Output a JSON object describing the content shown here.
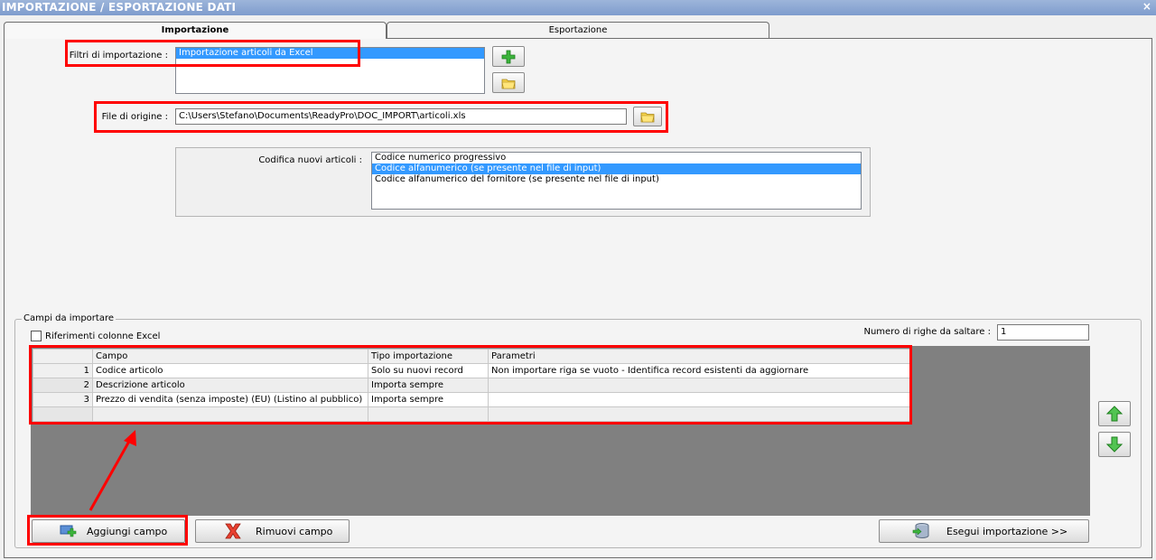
{
  "window": {
    "title": "IMPORTAZIONE / ESPORTAZIONE DATI",
    "close_glyph": "×"
  },
  "tabs": [
    {
      "label": "Importazione",
      "active": true
    },
    {
      "label": "Esportazione",
      "active": false
    }
  ],
  "import": {
    "filters_label": "Filtri di importazione :",
    "filters": [
      {
        "label": "Importazione articoli da Excel",
        "selected": true
      }
    ],
    "source_file_label": "File di origine :",
    "source_file_value": "C:\\Users\\Stefano\\Documents\\ReadyPro\\DOC_IMPORT\\articoli.xls",
    "coding_label": "Codifica nuovi articoli :",
    "coding_options": [
      {
        "label": "Codice numerico progressivo",
        "selected": false
      },
      {
        "label": "Codice alfanumerico (se presente nel file di input)",
        "selected": true
      },
      {
        "label": "Codice alfanumerico del fornitore (se presente nel file di input)",
        "selected": false
      }
    ]
  },
  "fields": {
    "legend": "Campi da importare",
    "excel_refs_label": "Riferimenti colonne Excel",
    "skip_rows_label": "Numero di righe da saltare :",
    "skip_rows_value": "1",
    "columns": [
      "Campo",
      "Tipo importazione",
      "Parametri"
    ],
    "rows": [
      {
        "n": "1",
        "campo": "Codice articolo",
        "tipo": "Solo su nuovi record",
        "parametri": "Non importare riga se vuoto - Identifica record esistenti da aggiornare"
      },
      {
        "n": "2",
        "campo": "Descrizione articolo",
        "tipo": "Importa sempre",
        "parametri": ""
      },
      {
        "n": "3",
        "campo": "Prezzo di vendita (senza imposte) (EU) (Listino al pubblico)",
        "tipo": "Importa sempre",
        "parametri": ""
      },
      {
        "n": "",
        "campo": "",
        "tipo": "",
        "parametri": ""
      }
    ]
  },
  "buttons": {
    "add_field": "Aggiungi campo",
    "remove_field": "Rimuovi campo",
    "run_import": "Esegui importazione >>"
  },
  "colors": {
    "highlight": "#ff0000",
    "selection": "#3399ff",
    "grid_bg": "#808080",
    "accent_green": "#3cb43c"
  }
}
